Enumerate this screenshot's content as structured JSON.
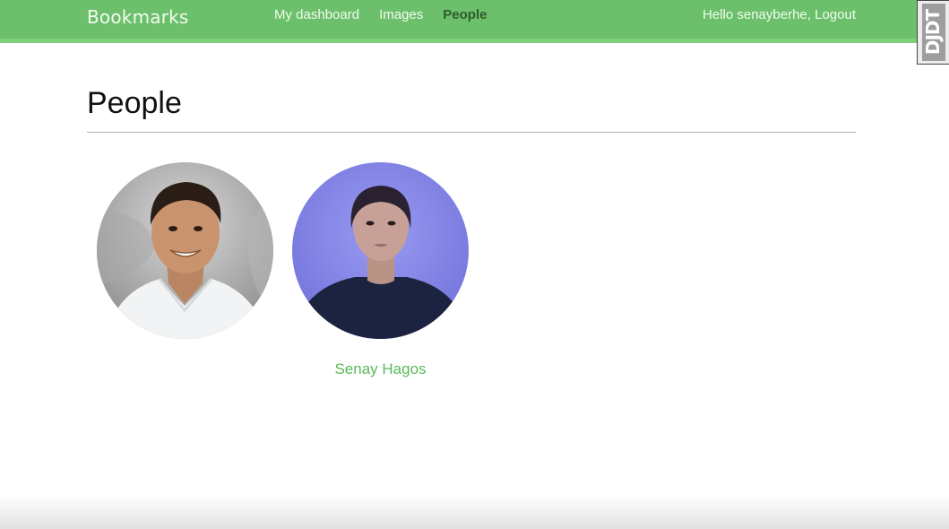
{
  "header": {
    "logo": "Bookmarks",
    "nav": [
      {
        "label": "My dashboard",
        "active": false
      },
      {
        "label": "Images",
        "active": false
      },
      {
        "label": "People",
        "active": true
      }
    ],
    "greeting": "Hello senayberhe,",
    "logout_label": "Logout"
  },
  "djdt": {
    "label": "DJDT"
  },
  "main": {
    "title": "People",
    "people": [
      {
        "name": "",
        "avatar": "man-portrait-photo"
      },
      {
        "name": "Senay Hagos",
        "avatar": "woman-portrait-photo"
      }
    ]
  },
  "colors": {
    "header_bg": "#6cc06b",
    "header_stripe": "#7fd07a",
    "active_nav": "#2e5b2a",
    "link": "#5cb85c"
  }
}
